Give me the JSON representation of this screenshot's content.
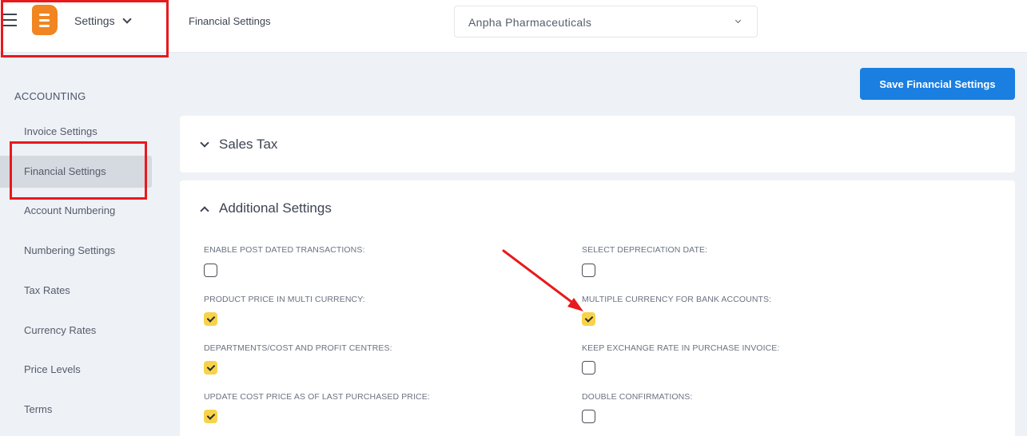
{
  "topbar": {
    "app_menu_label": "Settings",
    "page_title": "Financial Settings",
    "company": "Anpha Pharmaceuticals"
  },
  "sidebar": {
    "section_label": "ACCOUNTING",
    "items": [
      {
        "label": "Invoice Settings"
      },
      {
        "label": "Financial Settings"
      },
      {
        "label": "Account Numbering"
      },
      {
        "label": "Numbering Settings"
      },
      {
        "label": "Tax Rates"
      },
      {
        "label": "Currency Rates"
      },
      {
        "label": "Price Levels"
      },
      {
        "label": "Terms"
      }
    ],
    "active_index": 1
  },
  "main": {
    "save_label": "Save Financial Settings",
    "sales_tax_title": "Sales Tax",
    "additional_title": "Additional Settings",
    "options": [
      {
        "label": "ENABLE POST DATED TRANSACTIONS:",
        "checked": false
      },
      {
        "label": "SELECT DEPRECIATION DATE:",
        "checked": false
      },
      {
        "label": "PRODUCT PRICE IN MULTI CURRENCY:",
        "checked": true
      },
      {
        "label": "MULTIPLE CURRENCY FOR BANK ACCOUNTS:",
        "checked": true
      },
      {
        "label": "DEPARTMENTS/COST AND PROFIT CENTRES:",
        "checked": true
      },
      {
        "label": "KEEP EXCHANGE RATE IN PURCHASE INVOICE:",
        "checked": false
      },
      {
        "label": "UPDATE COST PRICE AS OF LAST PURCHASED PRICE:",
        "checked": true
      },
      {
        "label": "DOUBLE CONFIRMATIONS:",
        "checked": false
      }
    ]
  },
  "colors": {
    "primary": "#1a7fe0",
    "checked": "#f7d34a",
    "logo": "#f08522",
    "annotation": "#e8191d"
  }
}
